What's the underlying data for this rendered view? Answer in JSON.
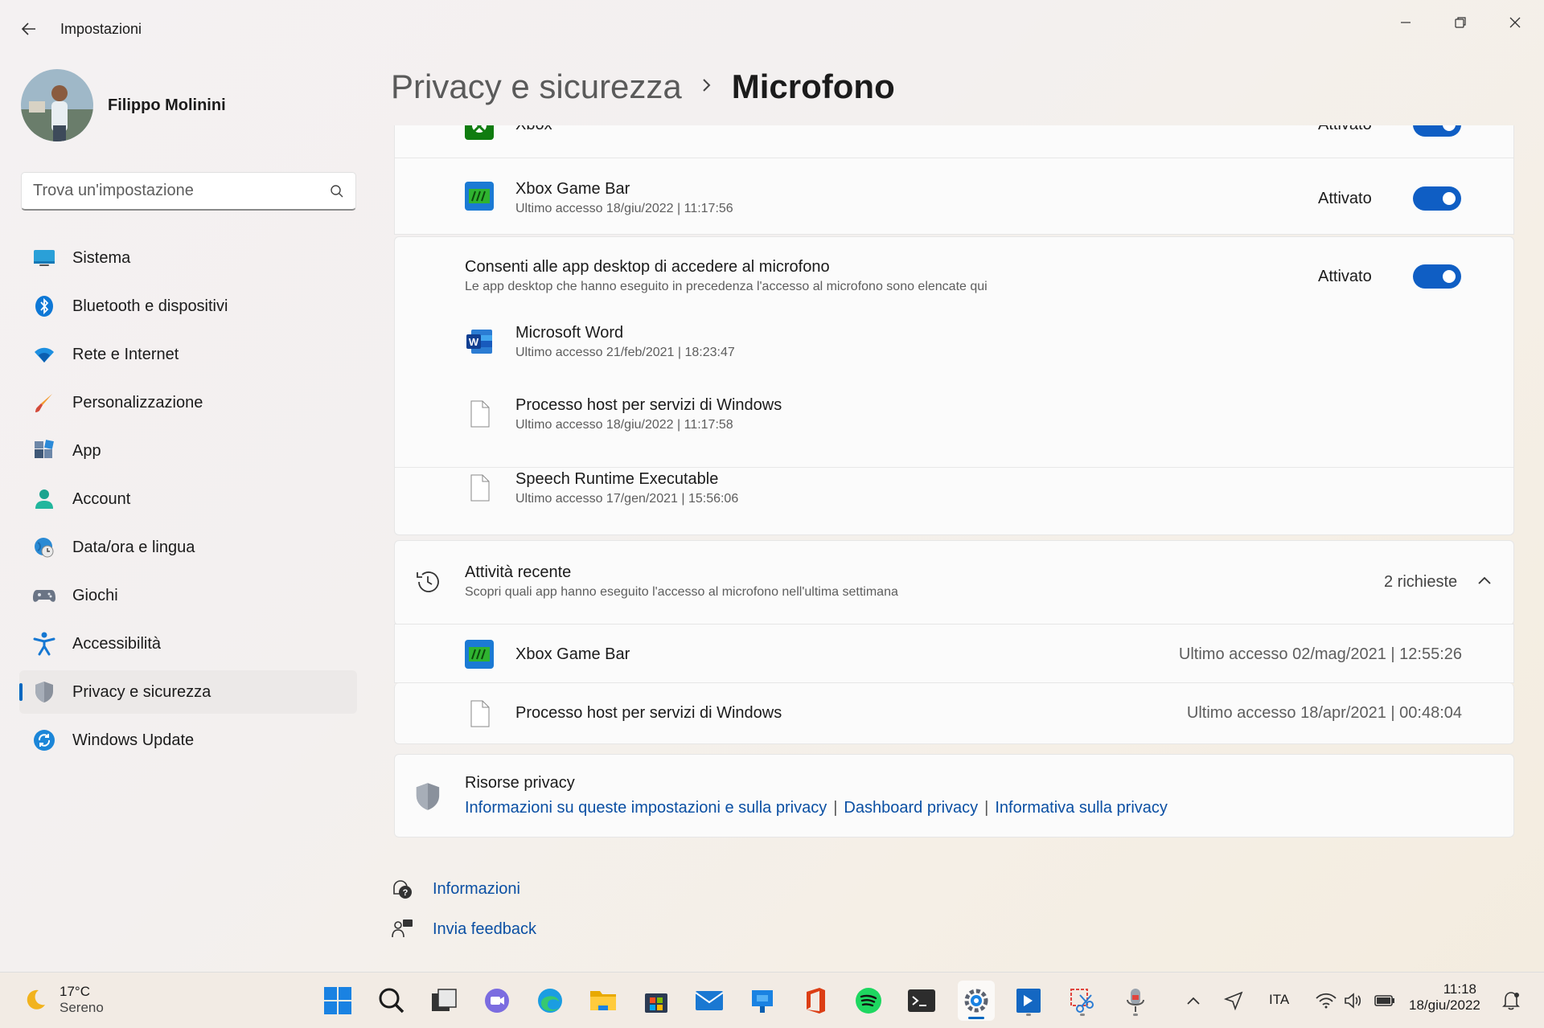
{
  "window": {
    "title": "Impostazioni"
  },
  "profile": {
    "name": "Filippo Molinini"
  },
  "search": {
    "placeholder": "Trova un'impostazione"
  },
  "sidebar": {
    "items": [
      {
        "label": "Sistema",
        "icon": "monitor-icon"
      },
      {
        "label": "Bluetooth e dispositivi",
        "icon": "bluetooth-icon"
      },
      {
        "label": "Rete e Internet",
        "icon": "wifi-icon"
      },
      {
        "label": "Personalizzazione",
        "icon": "brush-icon"
      },
      {
        "label": "App",
        "icon": "apps-icon"
      },
      {
        "label": "Account",
        "icon": "person-icon"
      },
      {
        "label": "Data/ora e lingua",
        "icon": "globe-clock-icon"
      },
      {
        "label": "Giochi",
        "icon": "gamepad-icon"
      },
      {
        "label": "Accessibilità",
        "icon": "accessibility-icon"
      },
      {
        "label": "Privacy e sicurezza",
        "icon": "shield-icon",
        "active": true
      },
      {
        "label": "Windows Update",
        "icon": "update-icon"
      }
    ]
  },
  "breadcrumb": {
    "parent": "Privacy e sicurezza",
    "separator": ">",
    "current": "Microfono"
  },
  "apps_top": {
    "partial": {
      "name": "Xbox",
      "status": "Attivato"
    },
    "xbox_game_bar": {
      "name": "Xbox Game Bar",
      "last_access": "Ultimo accesso 18/giu/2022  |  11:17:56",
      "status": "Attivato"
    }
  },
  "desktop_apps": {
    "title": "Consenti alle app desktop di accedere al microfono",
    "subtitle": "Le app desktop che hanno eseguito in precedenza l'accesso al microfono sono elencate qui",
    "status": "Attivato",
    "items": [
      {
        "name": "Microsoft Word",
        "last_access": "Ultimo accesso 21/feb/2021  |  18:23:47"
      },
      {
        "name": "Processo host per servizi di Windows",
        "last_access": "Ultimo accesso 18/giu/2022  |  11:17:58"
      },
      {
        "name": "Speech Runtime Executable",
        "last_access": "Ultimo accesso 17/gen/2021  |  15:56:06"
      }
    ]
  },
  "recent_activity": {
    "title": "Attività recente",
    "subtitle": "Scopri quali app hanno eseguito l'accesso al microfono nell'ultima settimana",
    "count": "2 richieste",
    "items": [
      {
        "name": "Xbox Game Bar",
        "last_access": "Ultimo accesso 02/mag/2021  |  12:55:26"
      },
      {
        "name": "Processo host per servizi di Windows",
        "last_access": "Ultimo accesso 18/apr/2021  |  00:48:04"
      }
    ]
  },
  "privacy_resources": {
    "title": "Risorse privacy",
    "links": [
      "Informazioni su queste impostazioni e sulla privacy",
      "Dashboard privacy",
      "Informativa sulla privacy"
    ]
  },
  "footer_links": {
    "info": "Informazioni",
    "feedback": "Invia feedback"
  },
  "taskbar": {
    "weather_temp": "17°C",
    "weather_desc": "Sereno",
    "language": "ITA",
    "time": "11:18",
    "date": "18/giu/2022"
  },
  "colors": {
    "accent": "#0f5ec4",
    "link": "#0a4fa3"
  }
}
